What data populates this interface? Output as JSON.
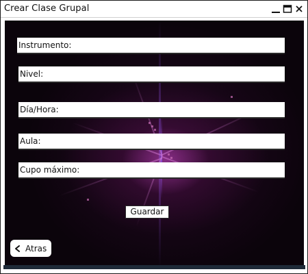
{
  "window": {
    "title": "Crear Clase Grupal",
    "controls": {
      "minimize_icon": "minimize-icon",
      "maximize_icon": "maximize-icon",
      "close_icon": "close-icon"
    }
  },
  "form": {
    "fields": [
      {
        "label": "Instrumento:",
        "value": ""
      },
      {
        "label": "Nivel:",
        "value": ""
      },
      {
        "label": "Día/Hora:",
        "value": ""
      },
      {
        "label": "Aula:",
        "value": ""
      },
      {
        "label": "Cupo máximo:",
        "value": ""
      }
    ],
    "save_label": "Guardar"
  },
  "navigation": {
    "back_label": "Atras",
    "back_icon": "chevron-left-icon"
  },
  "colors": {
    "background": "#0b040b",
    "accent_glow": "#be46be",
    "field_background": "#ffffff",
    "text": "#111111"
  }
}
